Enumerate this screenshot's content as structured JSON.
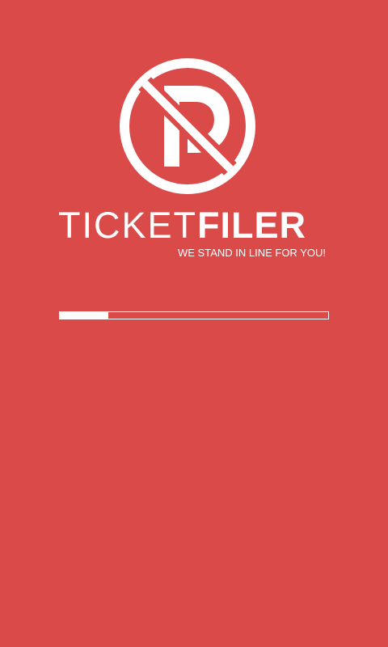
{
  "app": {
    "brand_light": "TICKET",
    "brand_bold": "FILER",
    "tagline": "WE STAND IN LINE FOR YOU!"
  },
  "logo": {
    "icon": "no-parking-icon",
    "color": "#ffffff"
  },
  "loading": {
    "progress": 0.18
  },
  "colors": {
    "background": "#d94a48",
    "foreground": "#ffffff"
  }
}
